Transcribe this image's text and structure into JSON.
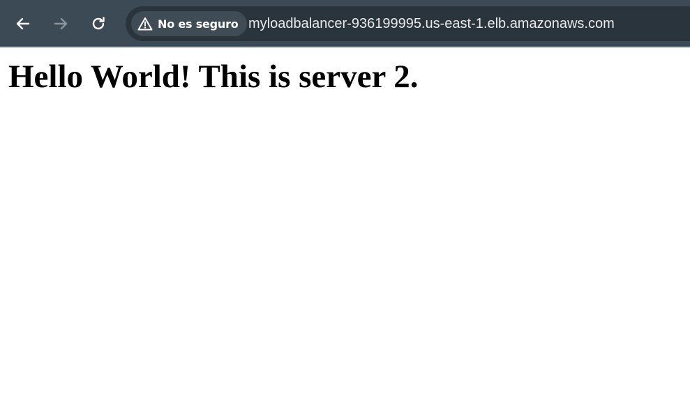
{
  "browser": {
    "colors": {
      "toolbar_bg": "#3c4a56",
      "omnibox_bg": "#2a343c",
      "chip_bg": "#3f4b55",
      "icon_enabled": "#ffffff",
      "icon_disabled": "#8a949c"
    },
    "nav": {
      "back_icon": "arrow-left-icon",
      "forward_icon": "arrow-right-icon",
      "forward_enabled": false,
      "reload_icon": "reload-icon"
    },
    "address_bar": {
      "security_icon": "warning-triangle-icon",
      "security_label": "No es seguro",
      "url": "myloadbalancer-936199995.us-east-1.elb.amazonaws.com"
    }
  },
  "page": {
    "heading": "Hello World! This is server 2."
  }
}
